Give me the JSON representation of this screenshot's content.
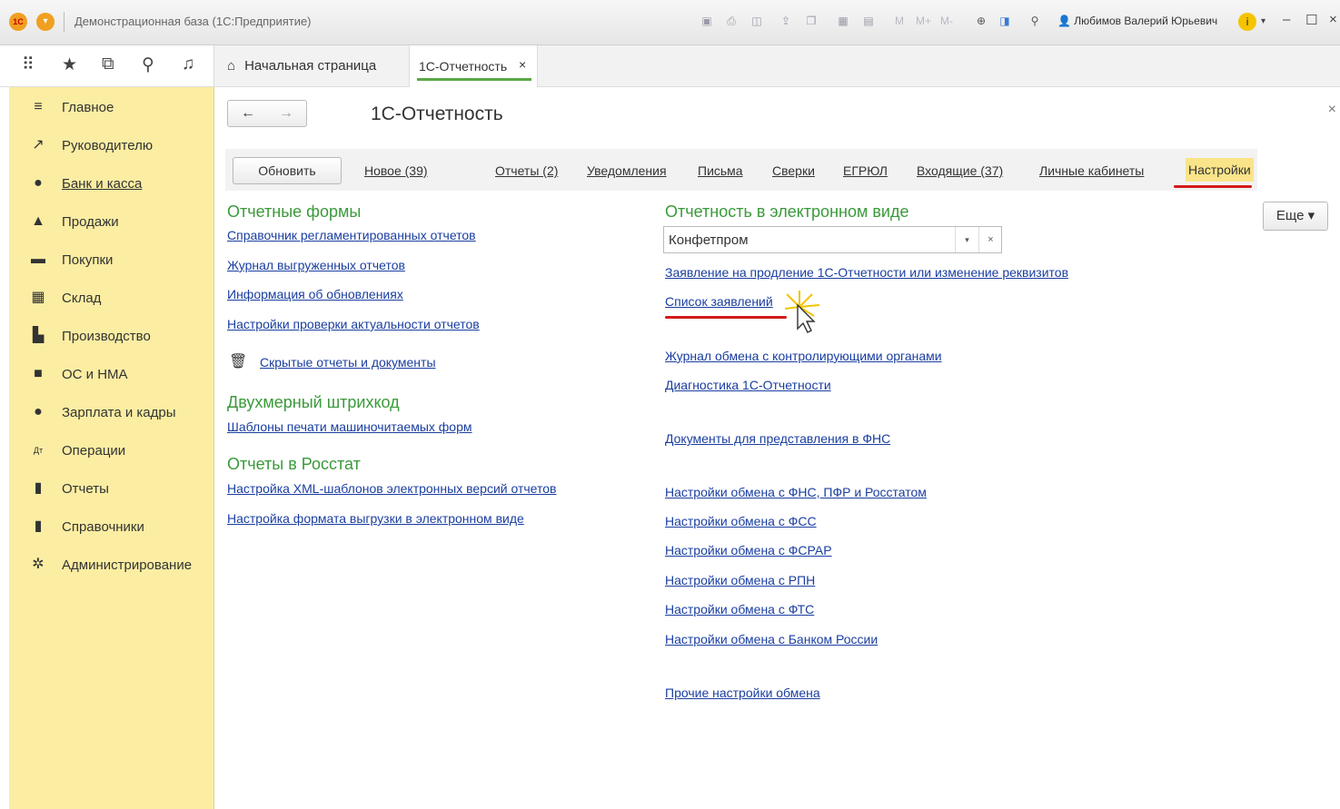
{
  "titlebar": {
    "logo_text": "1С",
    "title": "Демонстрационная база  (1С:Предприятие)",
    "mem_labels": [
      "M",
      "M+",
      "M-"
    ],
    "user": "Любимов Валерий Юрьевич",
    "info_symbol": "i"
  },
  "tabs": {
    "home_label": "Начальная страница",
    "active_label": "1С-Отчетность",
    "close_symbol": "×"
  },
  "sidebar": {
    "items": [
      {
        "label": "Главное",
        "icon": "menu-lines-icon",
        "glyph": "≡"
      },
      {
        "label": "Руководителю",
        "icon": "trend-chart-icon",
        "glyph": "↗"
      },
      {
        "label": "Банк и касса",
        "icon": "bank-coin-icon",
        "glyph": "●"
      },
      {
        "label": "Продажи",
        "icon": "shopping-bag-icon",
        "glyph": "▲"
      },
      {
        "label": "Покупки",
        "icon": "cart-icon",
        "glyph": "▬"
      },
      {
        "label": "Склад",
        "icon": "warehouse-icon",
        "glyph": "▦"
      },
      {
        "label": "Производство",
        "icon": "factory-icon",
        "glyph": "▙"
      },
      {
        "label": "ОС и НМА",
        "icon": "truck-icon",
        "glyph": "■"
      },
      {
        "label": "Зарплата и кадры",
        "icon": "person-icon",
        "glyph": "●"
      },
      {
        "label": "Операции",
        "icon": "debit-credit-icon",
        "glyph": "Дт"
      },
      {
        "label": "Отчеты",
        "icon": "bar-chart-icon",
        "glyph": "▮"
      },
      {
        "label": "Справочники",
        "icon": "book-icon",
        "glyph": "▮"
      },
      {
        "label": "Администрирование",
        "icon": "gear-icon",
        "glyph": "✲"
      }
    ]
  },
  "main": {
    "title": "1С-Отчетность",
    "close_symbol": "×",
    "refresh_label": "Обновить",
    "more_label": "Еще ▾",
    "commands": [
      "Новое (39)",
      "Отчеты (2)",
      "Уведомления",
      "Письма",
      "Сверки",
      "ЕГРЮЛ",
      "Входящие (37)",
      "Личные кабинеты"
    ],
    "settings_label": "Настройки",
    "left": {
      "forms_heading": "Отчетные формы",
      "forms_links": [
        "Справочник регламентированных отчетов",
        "Журнал выгруженных отчетов",
        "Информация об обновлениях",
        "Настройки проверки актуальности отчетов"
      ],
      "hidden_link": "Скрытые отчеты и документы",
      "barcode_heading": "Двухмерный штрихкод",
      "barcode_link": "Шаблоны печати машиночитаемых форм",
      "rosstat_heading": "Отчеты в Росстат",
      "rosstat_links": [
        "Настройка XML-шаблонов электронных версий отчетов",
        "Настройка формата выгрузки в электронном виде"
      ]
    },
    "right": {
      "heading": "Отчетность в электронном виде",
      "organization": "Конфетпром",
      "links": [
        "Заявление на продление 1С-Отчетности или изменение реквизитов",
        "Список заявлений",
        "Журнал обмена с контролирующими органами",
        "Диагностика 1С-Отчетности",
        "Документы для представления в ФНС",
        "Настройки обмена с ФНС, ПФР и Росстатом",
        "Настройки обмена с ФСС",
        "Настройки обмена с ФСРАР",
        "Настройки обмена с РПН",
        "Настройки обмена с ФТС",
        "Настройки обмена с Банком России",
        "Прочие настройки обмена"
      ]
    }
  },
  "colors": {
    "sidebar_bg": "#fbeda2",
    "heading_green": "#3a9a3a",
    "link_blue": "#1a3ea0",
    "highlight_red": "#d41a1a",
    "settings_bg": "#fae48a"
  }
}
